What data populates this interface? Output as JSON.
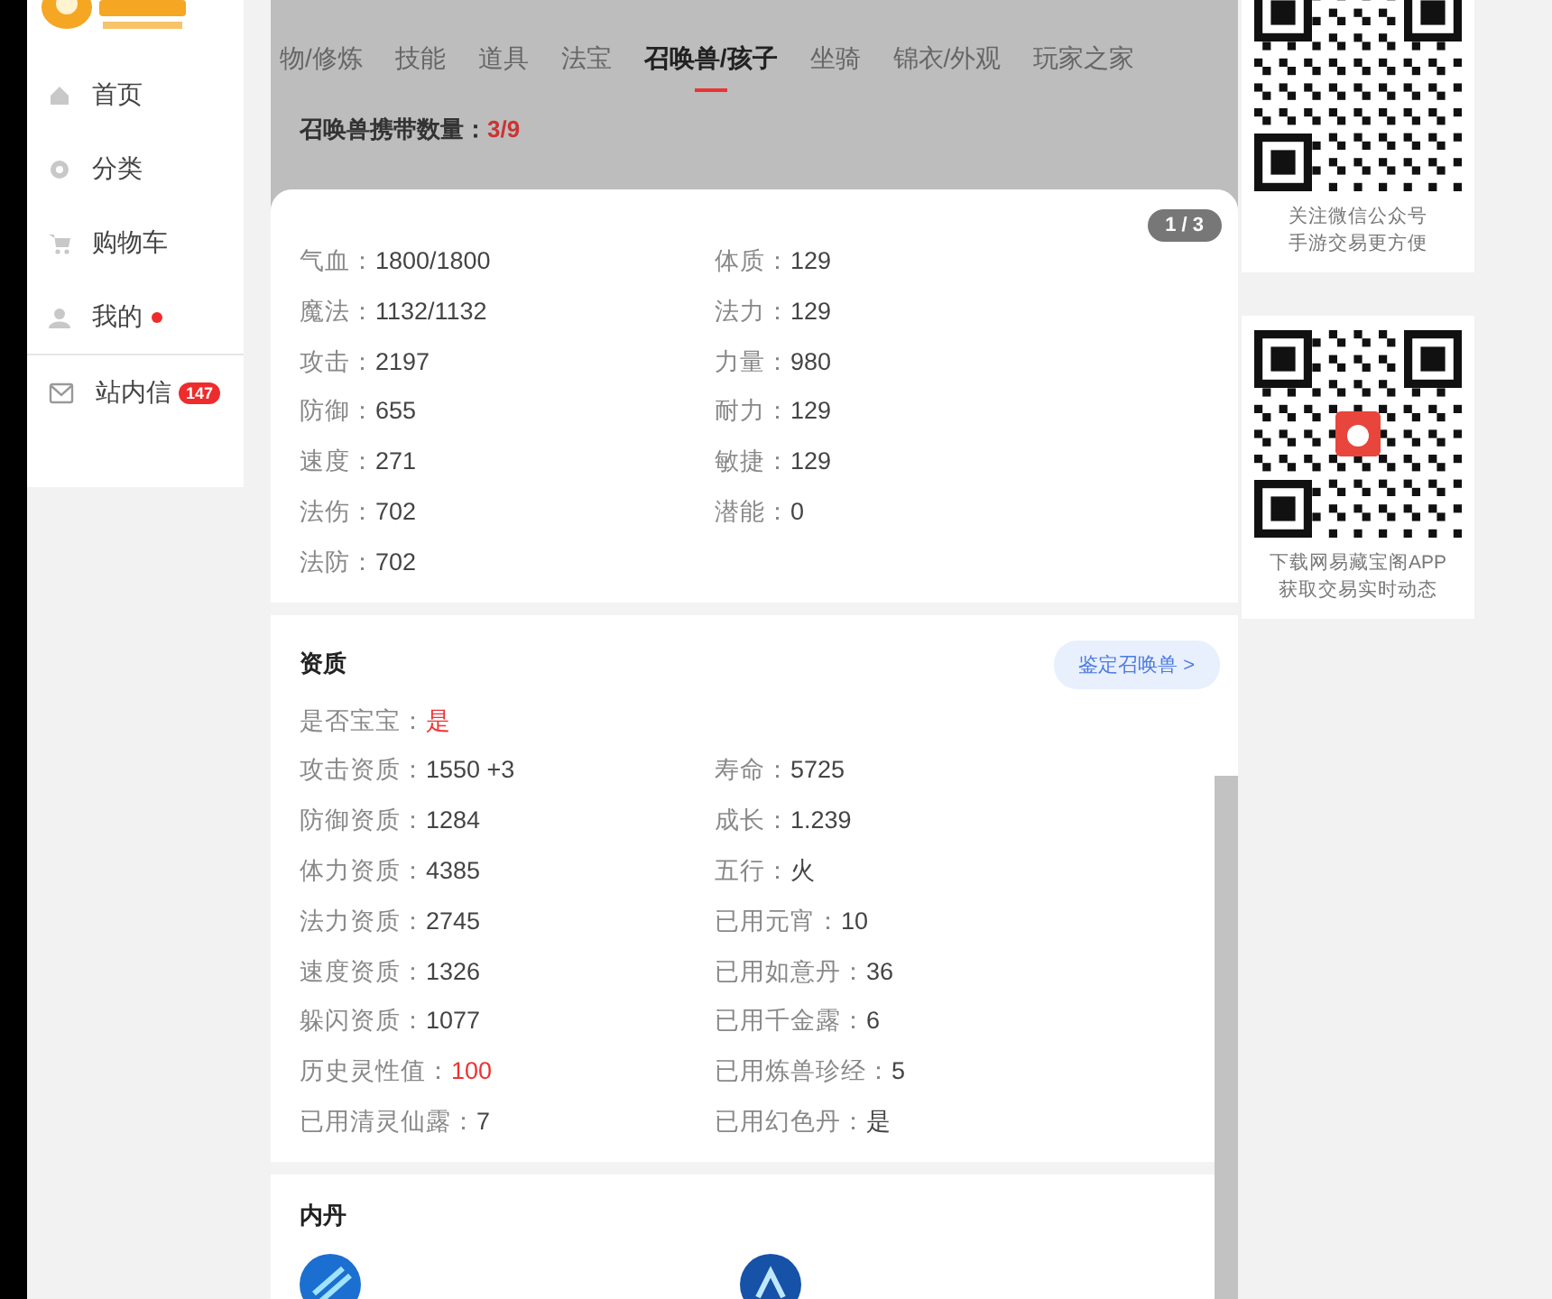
{
  "sidebar": {
    "items": [
      {
        "label": "首页",
        "selected": false,
        "dot": false
      },
      {
        "label": "分类",
        "selected": false,
        "dot": false
      },
      {
        "label": "购物车",
        "selected": false,
        "dot": false
      },
      {
        "label": "我的",
        "selected": false,
        "dot": true
      }
    ],
    "messages": {
      "label": "站内信",
      "badge": "147"
    }
  },
  "tabs": [
    {
      "label": "物/修炼",
      "selected": false
    },
    {
      "label": "技能",
      "selected": false
    },
    {
      "label": "道具",
      "selected": false
    },
    {
      "label": "法宝",
      "selected": false
    },
    {
      "label": "召唤兽/孩子",
      "selected": true
    },
    {
      "label": "坐骑",
      "selected": false
    },
    {
      "label": "锦衣/外观",
      "selected": false
    },
    {
      "label": "玩家之家",
      "selected": false
    }
  ],
  "carry_count": {
    "label": "召唤兽携带数量：",
    "value": "3/9"
  },
  "pager": "1 / 3",
  "stats_card": {
    "rows": [
      [
        {
          "label": "气血：",
          "value": "1800/1800",
          "accent": false
        },
        {
          "label": "体质：",
          "value": "129",
          "accent": false
        }
      ],
      [
        {
          "label": "魔法：",
          "value": "1132/1132",
          "accent": false
        },
        {
          "label": "法力：",
          "value": "129",
          "accent": false
        }
      ],
      [
        {
          "label": "攻击：",
          "value": "2197",
          "accent": false
        },
        {
          "label": "力量：",
          "value": "980",
          "accent": false
        }
      ],
      [
        {
          "label": "防御：",
          "value": "655",
          "accent": false
        },
        {
          "label": "耐力：",
          "value": "129",
          "accent": false
        }
      ],
      [
        {
          "label": "速度：",
          "value": "271",
          "accent": false
        },
        {
          "label": "敏捷：",
          "value": "129",
          "accent": false
        }
      ],
      [
        {
          "label": "法伤：",
          "value": "702",
          "accent": false
        },
        {
          "label": "潜能：",
          "value": "0",
          "accent": false
        }
      ],
      [
        {
          "label": "法防：",
          "value": "702",
          "accent": false
        }
      ]
    ]
  },
  "aptitude_card": {
    "title": "资质",
    "button": "鉴定召唤兽 >",
    "rows": [
      [
        {
          "label": "是否宝宝：",
          "value": "是",
          "accent": true
        }
      ],
      [
        {
          "label": "攻击资质：",
          "value": "1550 +3",
          "accent": false
        },
        {
          "label": "寿命：",
          "value": "5725",
          "accent": false
        }
      ],
      [
        {
          "label": "防御资质：",
          "value": "1284",
          "accent": false
        },
        {
          "label": "成长：",
          "value": "1.239",
          "accent": false
        }
      ],
      [
        {
          "label": "体力资质：",
          "value": "4385",
          "accent": false
        },
        {
          "label": "五行：",
          "value": "火",
          "accent": false
        }
      ],
      [
        {
          "label": "法力资质：",
          "value": "2745",
          "accent": false
        },
        {
          "label": "已用元宵：",
          "value": "10",
          "accent": false
        }
      ],
      [
        {
          "label": "速度资质：",
          "value": "1326",
          "accent": false
        },
        {
          "label": "已用如意丹：",
          "value": "36",
          "accent": false
        }
      ],
      [
        {
          "label": "躲闪资质：",
          "value": "1077",
          "accent": false
        },
        {
          "label": "已用千金露：",
          "value": "6",
          "accent": false
        }
      ],
      [
        {
          "label": "历史灵性值：",
          "value": "100",
          "accent": true
        },
        {
          "label": "已用炼兽珍经：",
          "value": "5",
          "accent": false
        }
      ],
      [
        {
          "label": "已用清灵仙露：",
          "value": "7",
          "accent": false
        },
        {
          "label": "已用幻色丹：",
          "value": "是",
          "accent": false
        }
      ]
    ]
  },
  "inner_core_card": {
    "title": "内丹"
  },
  "qr_cards": [
    {
      "lines": [
        "关注微信公众号",
        "手游交易更方便"
      ]
    },
    {
      "lines": [
        "下载网易藏宝阁APP",
        "获取交易实时动态"
      ]
    }
  ]
}
